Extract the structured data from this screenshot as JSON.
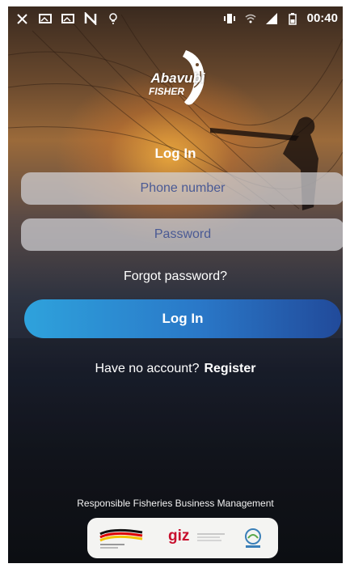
{
  "status_bar": {
    "time": "00:40",
    "icons_left": [
      "tools-icon",
      "image-icon",
      "image-icon",
      "n-icon",
      "lamp-icon"
    ],
    "icons_right": [
      "vibrate-icon",
      "wifi-icon",
      "signal-icon",
      "battery-icon"
    ]
  },
  "logo": {
    "word1": "Abavubi",
    "word2": "FISHER"
  },
  "login": {
    "title": "Log In",
    "phone_placeholder": "Phone number",
    "password_placeholder": "Password",
    "forgot": "Forgot password?",
    "button": "Log In",
    "no_account": "Have no account?",
    "register": "Register"
  },
  "footer": {
    "tagline": "Responsible Fisheries Business Management",
    "partners": [
      "german-government-logo",
      "giz",
      "embassy-logo"
    ],
    "giz_label": "giz"
  },
  "colors": {
    "button_start": "#2ea2dc",
    "button_end": "#214a9a",
    "field_bg": "#d2d2d7",
    "placeholder": "#4a5a94"
  }
}
